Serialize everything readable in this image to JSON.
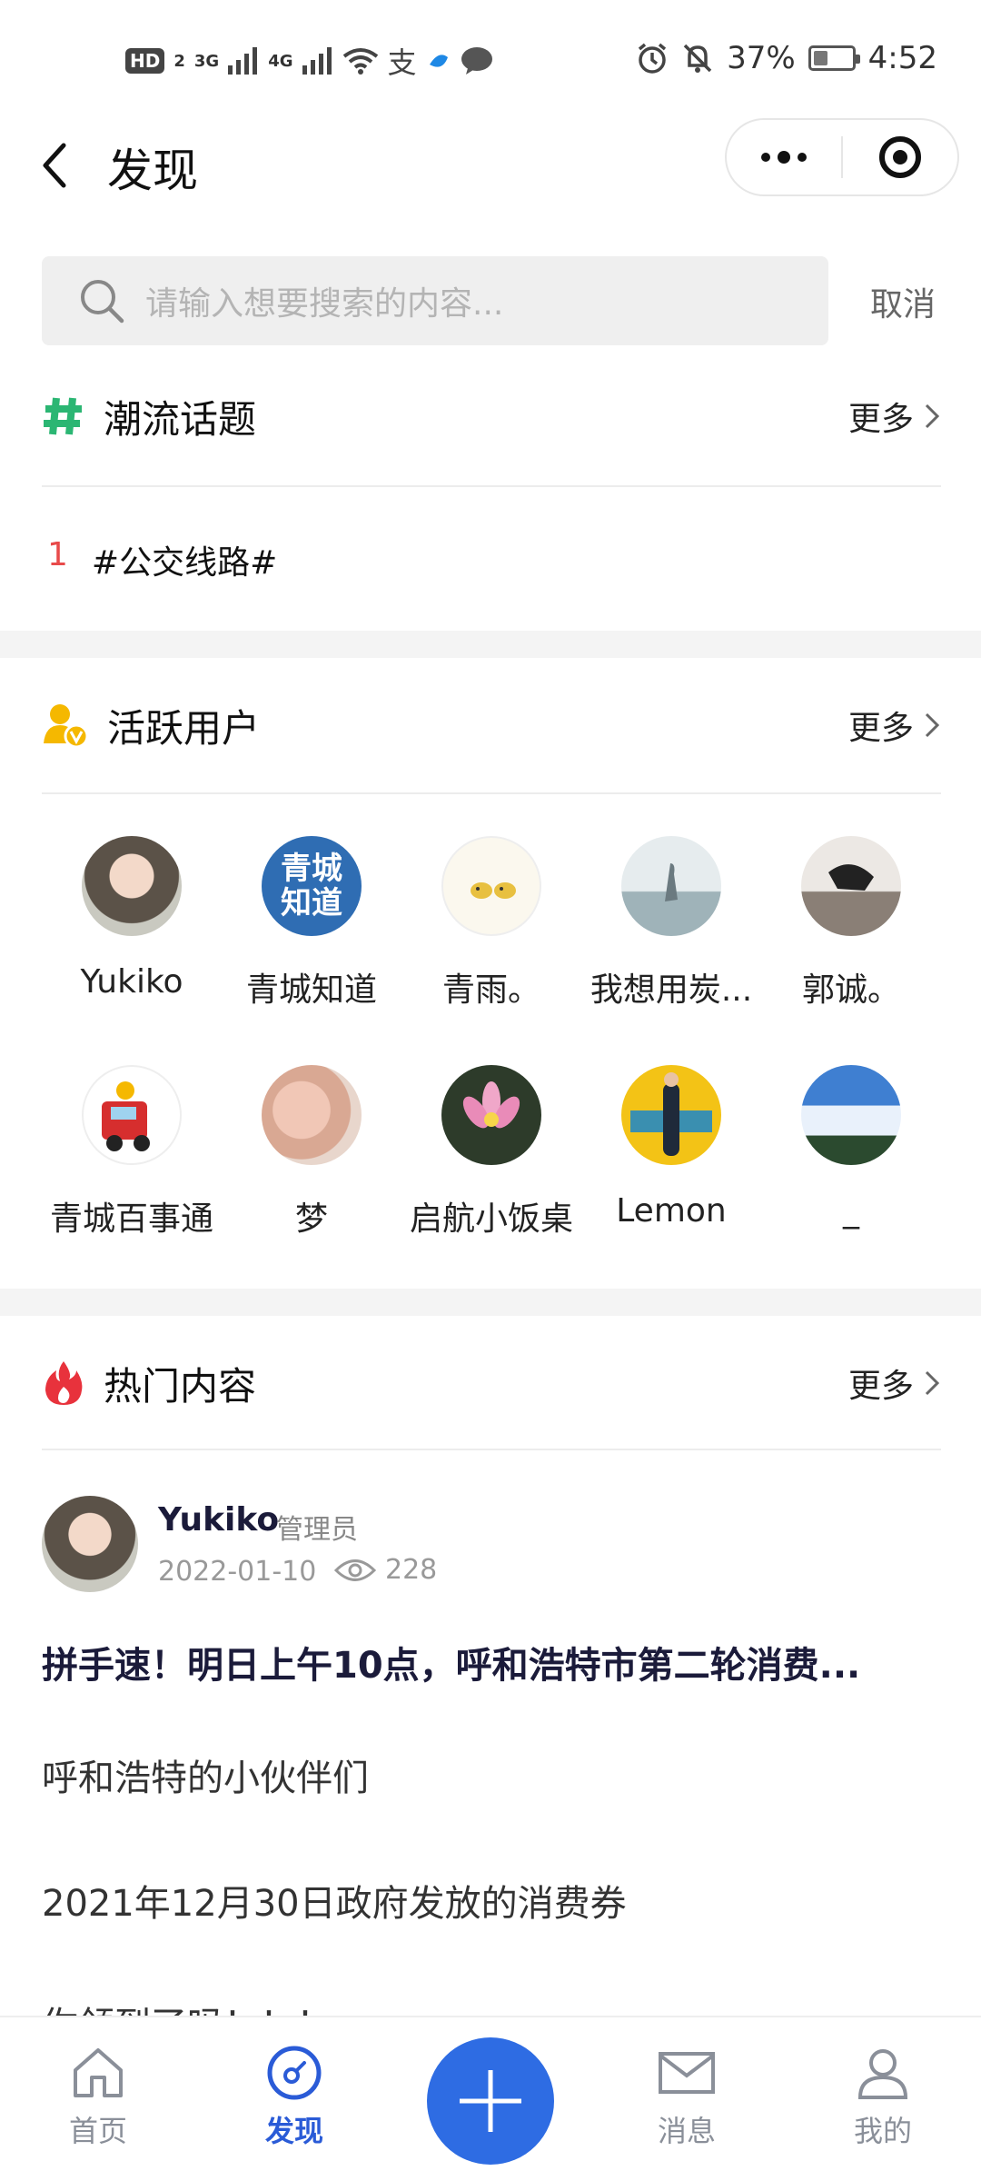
{
  "status_bar": {
    "hd_badge": "HD",
    "hd_sub": "2",
    "net1": "3G",
    "net2": "4G",
    "alipay_glyph": "支",
    "battery_text": "37%",
    "battery_level": 0.37,
    "time": "4:52"
  },
  "nav": {
    "title": "发现"
  },
  "search": {
    "placeholder": "请输入想要搜索的内容...",
    "cancel": "取消"
  },
  "topics": {
    "title": "潮流话题",
    "more": "更多",
    "items": [
      {
        "rank": "1",
        "text": "#公交线路#"
      }
    ]
  },
  "active_users": {
    "title": "活跃用户",
    "more": "更多",
    "users": [
      {
        "name": "Yukiko"
      },
      {
        "name": "青城知道",
        "avatar_text": "青城知道"
      },
      {
        "name": "青雨。"
      },
      {
        "name": "我想用炭..."
      },
      {
        "name": "郭诚。"
      },
      {
        "name": "青城百事通"
      },
      {
        "name": "梦"
      },
      {
        "name": "启航小饭桌"
      },
      {
        "name": "Lemon"
      },
      {
        "name": "_"
      }
    ]
  },
  "hot": {
    "title": "热门内容",
    "more": "更多",
    "post": {
      "author": "Yukiko",
      "role": "管理员",
      "date": "2022-01-10",
      "views": "228",
      "title": "拼手速！明日上午10点，呼和浩特市第二轮消费...",
      "paragraphs": [
        "呼和浩特的小伙伴们",
        "2021年12月30日政府发放的消费券",
        "你领到了吗！！！"
      ]
    }
  },
  "tabbar": {
    "tabs": [
      {
        "label": "首页"
      },
      {
        "label": "发现"
      },
      {
        "label": "消息"
      },
      {
        "label": "我的"
      }
    ],
    "active_color": "#2a5bd7",
    "fab_color": "#2e6ce3"
  }
}
